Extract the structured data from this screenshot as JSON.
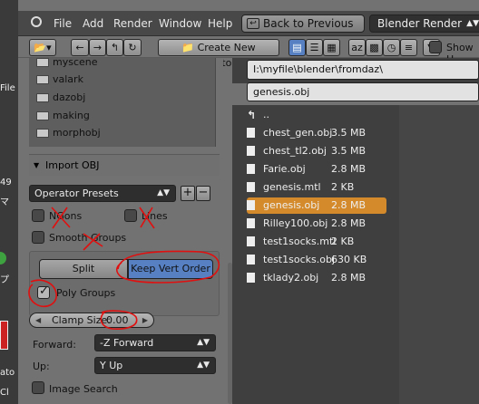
{
  "desktop_fragments": [
    "File",
    "49",
    "マ",
    "プ",
    "ato",
    "Cl"
  ],
  "menubar": {
    "items": [
      "File",
      "Add",
      "Render",
      "Window",
      "Help"
    ],
    "back_button": "Back to Previous",
    "render_engine": "Blender Render"
  },
  "toolbar": {
    "nav_icons": [
      "back-arrow-icon",
      "forward-arrow-icon",
      "parent-dir-icon",
      "refresh-icon"
    ],
    "create_dir_label": "Create New Directory",
    "view_icons": [
      "short-list-icon",
      "long-list-icon",
      "thumbnails-icon"
    ],
    "sort_icons": [
      "sort-alpha-icon",
      "sort-ext-icon",
      "sort-time-icon",
      "sort-size-icon"
    ],
    "filter_icon": "filter-icon",
    "show_hidden_label": "Show H"
  },
  "folders": [
    "myscene",
    "valark",
    "dazobj",
    "making",
    "morphobj"
  ],
  "import_obj": {
    "header": "Import OBJ",
    "operator_presets": "Operator Presets",
    "ngons_label": "NGons",
    "lines_label": "Lines",
    "smooth_groups_label": "Smooth Groups",
    "split_label": "Split",
    "keep_vert_order_label": "Keep Vert Order",
    "poly_groups_label": "Poly Groups",
    "clamp_size_label": "Clamp Size:",
    "clamp_size_value": "0.00",
    "forward_label": "Forward:",
    "forward_value": "-Z Forward",
    "up_label": "Up:",
    "up_value": "Y Up",
    "image_search_label": "Image Search",
    "poly_groups_checked": true
  },
  "browser": {
    "path": "I:\\myfile\\blender\\fromdaz\\",
    "filename": "genesis.obj",
    "parent_label": "..",
    "files": [
      {
        "name": "chest_gen.obj",
        "size": "3.5 MB"
      },
      {
        "name": "chest_tl2.obj",
        "size": "3.5 MB"
      },
      {
        "name": "Farie.obj",
        "size": "2.8 MB"
      },
      {
        "name": "genesis.mtl",
        "size": "2 KB"
      },
      {
        "name": "genesis.obj",
        "size": "2.8 MB",
        "selected": true
      },
      {
        "name": "Rilley100.obj",
        "size": "2.8 MB"
      },
      {
        "name": "test1socks.mtl",
        "size": "2 KB"
      },
      {
        "name": "test1socks.obj",
        "size": "630 KB"
      },
      {
        "name": "tklady2.obj",
        "size": "2.8 MB"
      }
    ]
  },
  "colors": {
    "selection": "#d48a2a",
    "active_toggle": "#5680c2",
    "annotation": "#e01010"
  }
}
